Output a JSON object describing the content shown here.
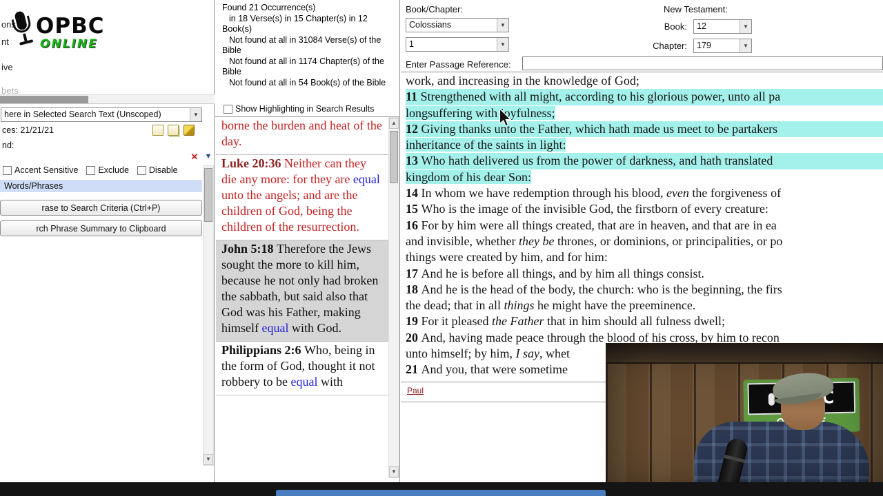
{
  "overlay": {
    "logo_text": "OPBC",
    "logo_online": "ONLINE"
  },
  "left_menu_fragments": [
    "ons",
    "nt",
    "ive",
    "bets"
  ],
  "search_panel": {
    "scope_value": "here in Selected Search Text (Unscoped)",
    "occurrences_text": "ces: 21/21/21",
    "find_label": "nd:",
    "accent_checkbox": "Accent Sensitive",
    "exclude_checkbox": "Exclude",
    "disable_checkbox": "Disable",
    "section_header": "Words/Phrases",
    "button_add_phrase": "rase to Search Criteria (Ctrl+P)",
    "button_copy_summary": "rch Phrase Summary to Clipboard"
  },
  "results_panel": {
    "stats": [
      "Found 21 Occurrence(s)",
      "in 18 Verse(s) in 15 Chapter(s) in 12 Book(s)",
      "Not found at all in 31084 Verse(s) of the Bible",
      "Not found at all in 1174 Chapter(s) of the Bible",
      "Not found at all in 54 Book(s) of the Bible"
    ],
    "show_highlighting_label": "Show Highlighting in Search Results",
    "items": [
      {
        "sel": false,
        "segs": [
          {
            "t": "borne the burden and heat of the day.",
            "c": "red"
          }
        ]
      },
      {
        "sel": false,
        "segs": [
          {
            "t": "Luke 20:36 ",
            "b": true,
            "c": "maroon"
          },
          {
            "t": "Neither can they die any more: for they are ",
            "c": "red"
          },
          {
            "t": "equal",
            "c": "blue"
          },
          {
            "t": " unto the angels; and are the children of God, being the children of the resurrection.",
            "c": "red"
          }
        ]
      },
      {
        "sel": true,
        "segs": [
          {
            "t": "John 5:18 ",
            "b": true
          },
          {
            "t": "Therefore the Jews sought the more to kill him, because he not only had broken the sabbath, but said also that God was his Father, making himself "
          },
          {
            "t": "equal",
            "c": "blue"
          },
          {
            "t": " with God."
          }
        ]
      },
      {
        "sel": false,
        "segs": [
          {
            "t": "Philippians 2:6 ",
            "b": true
          },
          {
            "t": "Who, being in the form of God, thought it not robbery to be "
          },
          {
            "t": "equal",
            "c": "blue"
          },
          {
            "t": " with"
          }
        ]
      }
    ]
  },
  "bible_panel": {
    "book_chapter_label": "Book/Chapter:",
    "book_value": "Colossians",
    "chapter_value": "1",
    "new_testament_label": "New Testament:",
    "book_label": "Book:",
    "book_index": "12",
    "chapter_label": "Chapter:",
    "chapter_index": "179",
    "passage_label": "Enter Passage Reference:",
    "passage_value": "",
    "footer_link": "Paul",
    "lines": [
      {
        "hl": "none",
        "segs": [
          {
            "t": "work, and increasing in the knowledge of God;"
          }
        ]
      },
      {
        "hl": "full",
        "segs": [
          {
            "t": "11 ",
            "b": true
          },
          {
            "t": "Strengthened with all might, according to his glorious power, unto all pa"
          }
        ]
      },
      {
        "hl": "inline",
        "segs": [
          {
            "t": "longsuffering with joyfulness;"
          }
        ]
      },
      {
        "hl": "full",
        "segs": [
          {
            "t": "12 ",
            "b": true
          },
          {
            "t": "Giving thanks unto the Father, which hath made us meet to be partakers"
          }
        ]
      },
      {
        "hl": "inline",
        "segs": [
          {
            "t": "inheritance of the saints in light:"
          }
        ]
      },
      {
        "hl": "full",
        "segs": [
          {
            "t": "13 ",
            "b": true
          },
          {
            "t": "Who hath delivered us from the power of darkness, and hath translated"
          }
        ]
      },
      {
        "hl": "inline",
        "segs": [
          {
            "t": "kingdom of his dear Son:"
          }
        ]
      },
      {
        "hl": "none",
        "segs": [
          {
            "t": "14 ",
            "b": true
          },
          {
            "t": "In whom we have redemption through his blood, "
          },
          {
            "t": "even",
            "i": true
          },
          {
            "t": " the forgiveness of"
          }
        ]
      },
      {
        "hl": "none",
        "segs": [
          {
            "t": "15 ",
            "b": true
          },
          {
            "t": "Who is the image of the invisible God, the firstborn of every creature:"
          }
        ]
      },
      {
        "hl": "none",
        "segs": [
          {
            "t": "16 ",
            "b": true
          },
          {
            "t": "For by him were all things created, that are in heaven, and that are in ea"
          }
        ]
      },
      {
        "hl": "none",
        "segs": [
          {
            "t": "and invisible, whether "
          },
          {
            "t": "they be",
            "i": true
          },
          {
            "t": " thrones, or dominions, or principalities, or po"
          }
        ]
      },
      {
        "hl": "none",
        "segs": [
          {
            "t": "things were created by him, and for him:"
          }
        ]
      },
      {
        "hl": "none",
        "segs": [
          {
            "t": "17 ",
            "b": true
          },
          {
            "t": "And he is before all things, and by him all things consist."
          }
        ]
      },
      {
        "hl": "none",
        "segs": [
          {
            "t": "18 ",
            "b": true
          },
          {
            "t": "And he is the head of the body, the church: who is the beginning, the firs"
          }
        ]
      },
      {
        "hl": "none",
        "segs": [
          {
            "t": "the dead; that in all "
          },
          {
            "t": "things",
            "i": true
          },
          {
            "t": " he might have the preeminence."
          }
        ]
      },
      {
        "hl": "none",
        "segs": [
          {
            "t": "19 ",
            "b": true
          },
          {
            "t": "For it pleased "
          },
          {
            "t": "the Father",
            "i": true
          },
          {
            "t": " that in him should all fulness dwell;"
          }
        ]
      },
      {
        "hl": "none",
        "segs": [
          {
            "t": "20 ",
            "b": true
          },
          {
            "t": "And, having made peace through the blood of his cross, by him to recon"
          }
        ]
      },
      {
        "hl": "none",
        "segs": [
          {
            "t": "unto himself; by him, "
          },
          {
            "t": "I say",
            "i": true
          },
          {
            "t": ", whet"
          }
        ]
      },
      {
        "hl": "none",
        "segs": [
          {
            "t": "21 ",
            "b": true
          },
          {
            "t": "And you, that were sometime"
          }
        ]
      }
    ]
  },
  "webcam": {
    "sign_top": "OPBC",
    "sign_bottom": "ONLINE"
  },
  "colors": {
    "highlight": "#a4f1ec",
    "selection": "#d5d5d5",
    "red_text": "#c32222",
    "blue_text": "#2323d8",
    "maroon_ref": "#8b1f1f",
    "logo_green": "#14b514",
    "taskbar_item_blue": "#4a7cc2"
  }
}
